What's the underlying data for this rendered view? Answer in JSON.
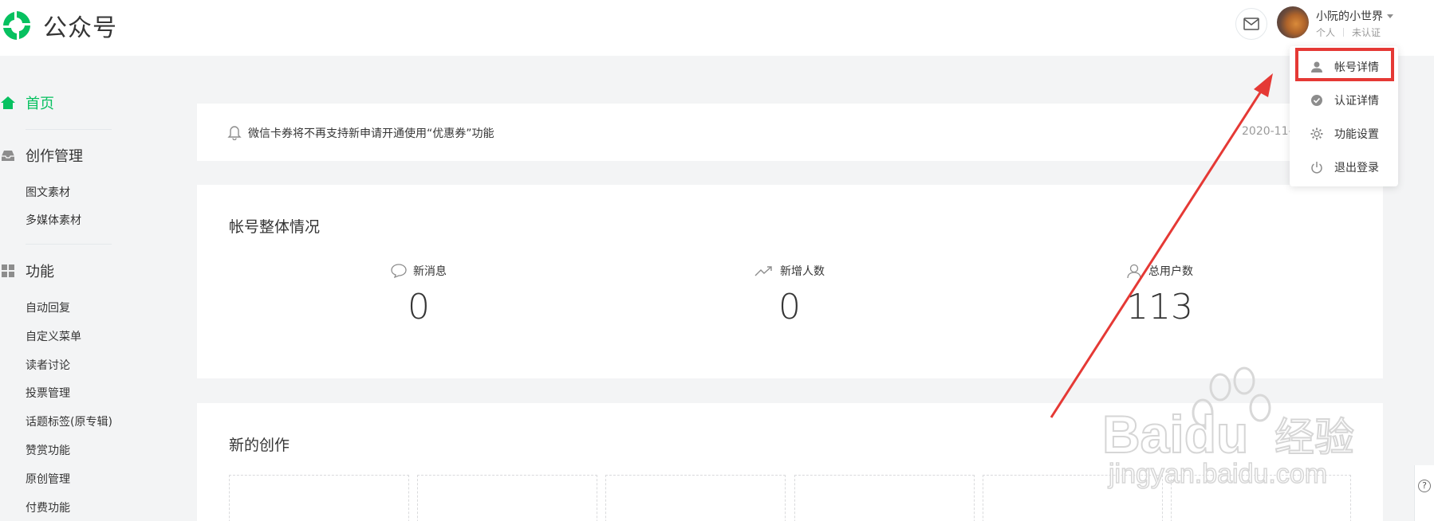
{
  "header": {
    "app_name": "公众号",
    "account": {
      "name": "小阮的小世界",
      "type": "个人",
      "verification": "未认证"
    },
    "colors": {
      "brand": "#07c160"
    }
  },
  "sidebar": {
    "home_label": "首页",
    "sections": [
      {
        "label": "创作管理",
        "icon": "inbox-icon",
        "items": [
          "图文素材",
          "多媒体素材"
        ]
      },
      {
        "label": "功能",
        "icon": "grid-icon",
        "items": [
          "自动回复",
          "自定义菜单",
          "读者讨论",
          "投票管理",
          "话题标签(原专辑)",
          "赞赏功能",
          "原创管理",
          "付费功能"
        ]
      }
    ]
  },
  "notice": {
    "text": "微信卡券将不再支持新申请开通使用“优惠券”功能",
    "date": "2020-11-"
  },
  "overview": {
    "title": "帐号整体情况",
    "stats": [
      {
        "label": "新消息",
        "value": "0",
        "icon": "chat-bubble-icon"
      },
      {
        "label": "新增人数",
        "value": "0",
        "icon": "trend-up-icon"
      },
      {
        "label": "总用户数",
        "value": "113",
        "icon": "user-icon"
      }
    ]
  },
  "creation": {
    "title": "新的创作"
  },
  "dropdown": {
    "items": [
      {
        "label": "帐号详情",
        "icon": "person-icon"
      },
      {
        "label": "认证详情",
        "icon": "check-circle-icon"
      },
      {
        "label": "功能设置",
        "icon": "gear-icon"
      },
      {
        "label": "退出登录",
        "icon": "power-icon"
      }
    ]
  },
  "watermark": {
    "brand": "Baidu",
    "sub": "经验",
    "url": "jingyan.baidu.com"
  },
  "help": {
    "glyph": "?"
  }
}
